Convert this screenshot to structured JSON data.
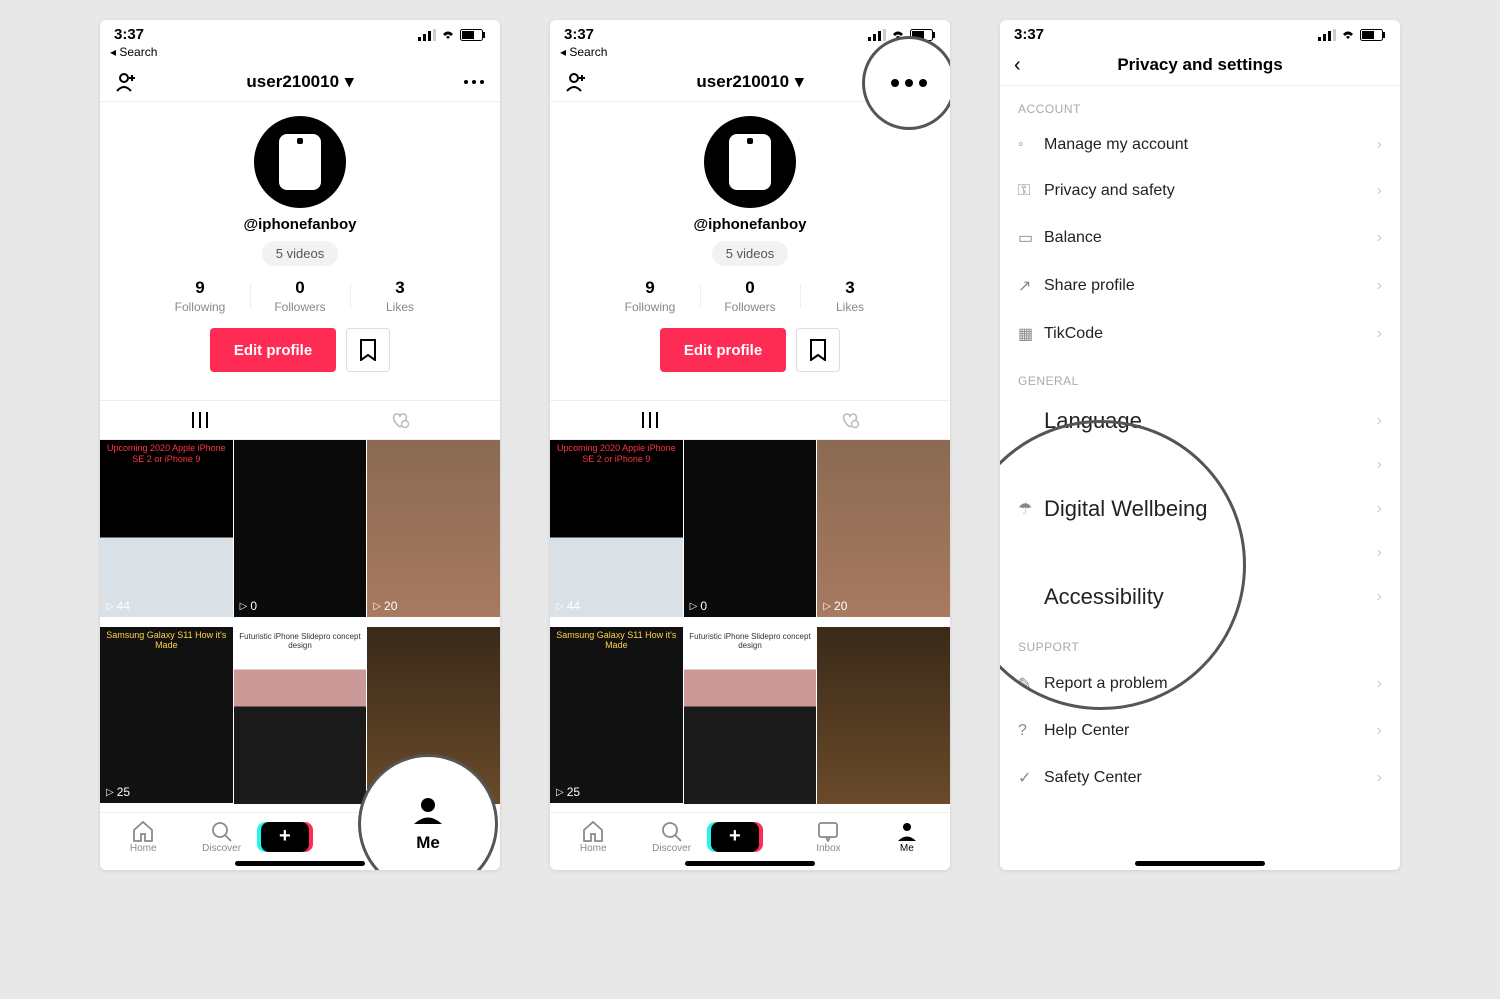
{
  "status": {
    "time": "3:37",
    "back": "Search"
  },
  "profile": {
    "username": "user210010",
    "handle": "@iphonefanboy",
    "videos_chip": "5 videos",
    "stats": {
      "following_n": "9",
      "following_l": "Following",
      "followers_n": "0",
      "followers_l": "Followers",
      "likes_n": "3",
      "likes_l": "Likes"
    },
    "edit": "Edit profile"
  },
  "grid": {
    "c1_title": "Upcoming 2020 Apple iPhone SE 2 or iPhone 9",
    "c4_title": "Samsung Galaxy S11 How it's Made",
    "c5_title": "Futuristic iPhone Slidepro concept design",
    "v1": "44",
    "v2": "0",
    "v3": "20",
    "v4": "25"
  },
  "nav": {
    "home": "Home",
    "discover": "Discover",
    "inbox": "Inbox",
    "me": "Me"
  },
  "settings": {
    "title": "Privacy and settings",
    "account": "ACCOUNT",
    "general": "GENERAL",
    "support": "SUPPORT",
    "rows": {
      "manage": "Manage my account",
      "privacy": "Privacy and safety",
      "balance": "Balance",
      "share": "Share profile",
      "tikcode": "TikCode",
      "language": "Language",
      "wellbeing": "Digital Wellbeing",
      "accessibility": "Accessibility",
      "report": "Report a problem",
      "help": "Help Center",
      "safety": "Safety Center"
    }
  }
}
